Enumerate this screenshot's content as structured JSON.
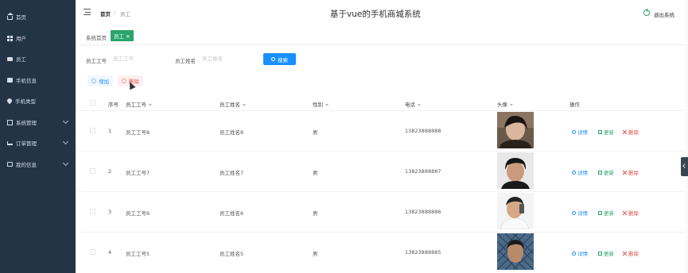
{
  "sidebar": {
    "items": [
      {
        "label": "首页",
        "icon": "home-icon"
      },
      {
        "label": "用户",
        "icon": "grid-icon"
      },
      {
        "label": "员工",
        "icon": "card-icon"
      },
      {
        "label": "手机信息",
        "icon": "chat-icon"
      },
      {
        "label": "手机类型",
        "icon": "pin-icon"
      },
      {
        "label": "系统管理",
        "icon": "box-icon"
      },
      {
        "label": "订单管理",
        "icon": "cart-icon"
      },
      {
        "label": "我的信息",
        "icon": "idcard-icon"
      }
    ]
  },
  "header": {
    "breadcrumb_home": "首页",
    "breadcrumb_sep": "/",
    "breadcrumb_current": "员工",
    "title": "基于vue的手机商城系统",
    "logout": "退出系统"
  },
  "tabs": {
    "home": "系统首页",
    "active": "员工 ✕"
  },
  "search": {
    "id_label": "员工工号",
    "id_placeholder": "员工工号",
    "name_label": "员工姓名",
    "name_placeholder": "员工姓名",
    "button": "搜索"
  },
  "actions": {
    "add": "增加",
    "delete": "删除"
  },
  "table": {
    "headers": [
      "序号",
      "员工工号",
      "员工姓名",
      "性别",
      "电话",
      "头像",
      "操作"
    ],
    "rows": [
      {
        "no": "1",
        "id": "员工工号8",
        "name": "员工姓名8",
        "gender": "男",
        "phone": "13823888888"
      },
      {
        "no": "2",
        "id": "员工工号7",
        "name": "员工姓名7",
        "gender": "男",
        "phone": "13823888887"
      },
      {
        "no": "3",
        "id": "员工工号6",
        "name": "员工姓名6",
        "gender": "男",
        "phone": "13823888886"
      },
      {
        "no": "4",
        "id": "员工工号5",
        "name": "员工姓名5",
        "gender": "男",
        "phone": "13823888885"
      }
    ],
    "row_actions": {
      "detail": "详情",
      "update": "更新",
      "remove": "删除"
    }
  },
  "colors": {
    "sidebar_bg": "#243447",
    "accent_green": "#2ba56b",
    "primary_blue": "#1890ff",
    "danger_red": "#d9534f"
  }
}
